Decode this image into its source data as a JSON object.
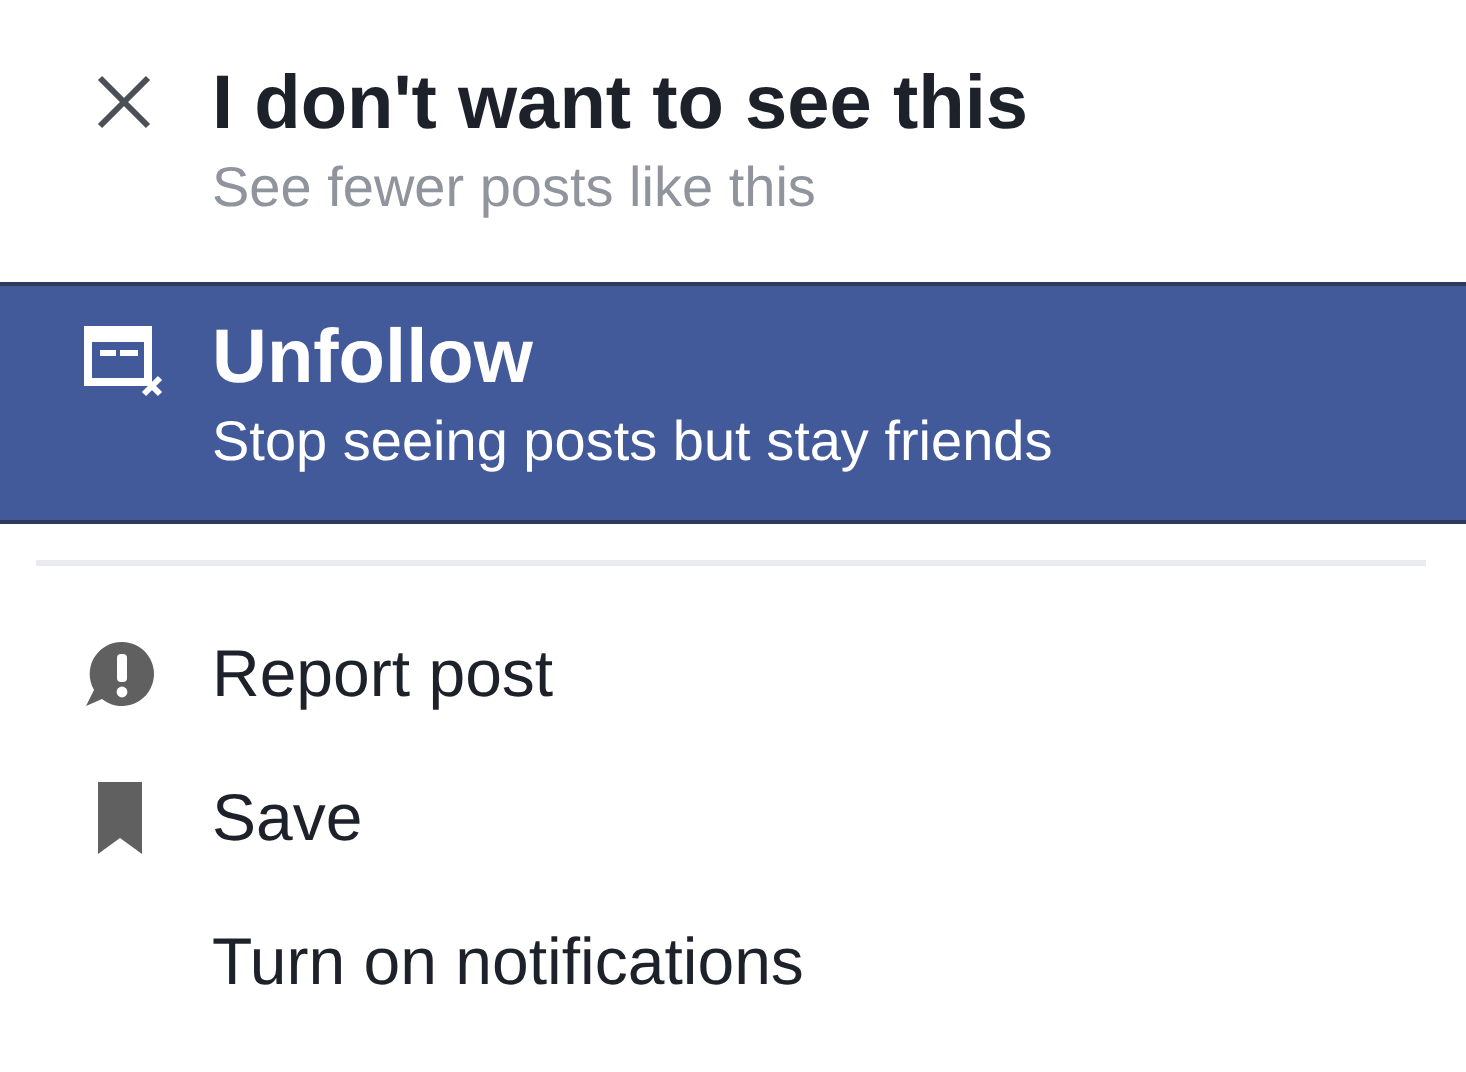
{
  "options": [
    {
      "kind": "hide",
      "title": "I don't want to see this",
      "subtitle": "See fewer posts like this",
      "selected": false
    },
    {
      "kind": "unfollow",
      "title": "Unfollow",
      "subtitle": "Stop seeing posts but stay friends",
      "selected": true
    }
  ],
  "actions": [
    {
      "kind": "report",
      "label": "Report post"
    },
    {
      "kind": "save",
      "label": "Save"
    },
    {
      "kind": "notify",
      "label": "Turn on notifications"
    }
  ]
}
